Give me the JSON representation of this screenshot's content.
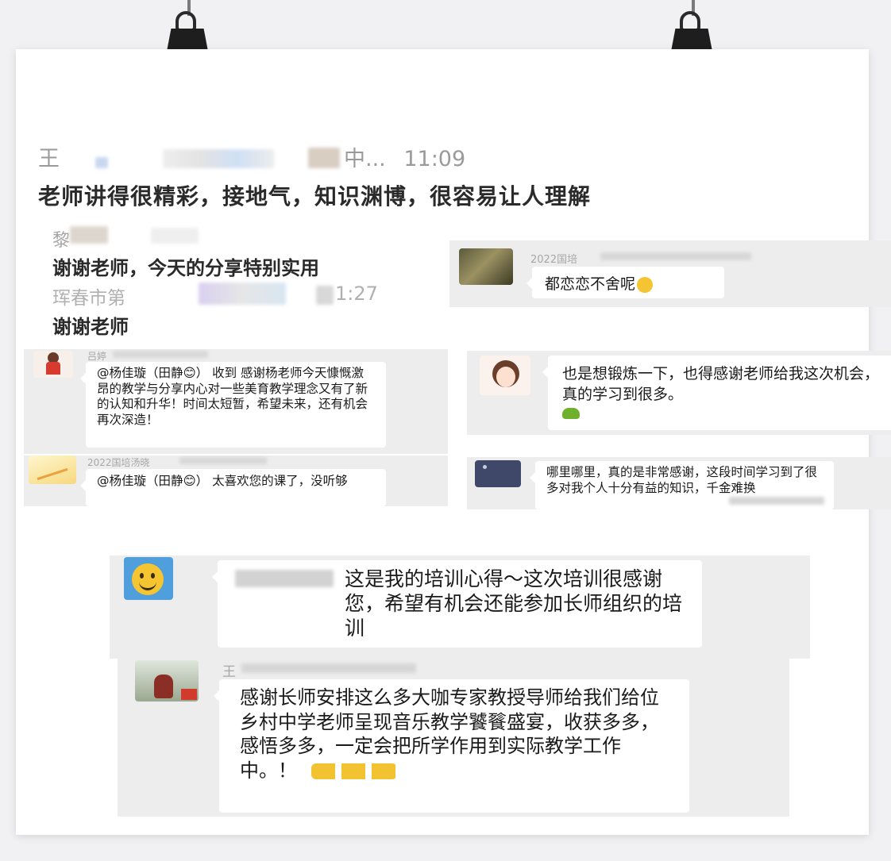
{
  "top": {
    "sender_name": "王",
    "sender_suffix": "中...",
    "time": "11:09",
    "message": "老师讲得很精彩，接地气，知识渊博，很容易让人理解"
  },
  "chat_2": {
    "sender": "黎",
    "message": "谢谢老师，今天的分享特别实用"
  },
  "chat_3": {
    "sender": "珲春市第",
    "time": "1:27",
    "message": "谢谢老师"
  },
  "card_a": {
    "group_name": "2022国培",
    "message": "都恋恋不舍呢"
  },
  "card_b": {
    "sender": "吕婷",
    "mention": "@杨佳璇（田静",
    "message": "@杨佳璇（田静😊） 收到 感谢杨老师今天慷慨激昂的教学与分享内心对一些美育教学理念又有了新的认知和升华！时间太短暂，希望未来，还有机会再次深造！"
  },
  "card_c": {
    "message": "也是想锻炼一下，也得感谢老师给我这次机会，真的学习到很多。"
  },
  "card_d": {
    "group_name": "2022国培汤晓",
    "message": "@杨佳璇（田静😊） 太喜欢您的课了，没听够"
  },
  "card_e": {
    "message": "哪里哪里，真的是非常感谢，这段时间学习到了很多对我个人十分有益的知识，千金难换"
  },
  "card_f": {
    "message": "这是我的培训心得～这次培训很感谢您，希望有机会还能参加长师组织的培训"
  },
  "card_g": {
    "sender": "王",
    "message": "感谢长师安排这么多大咖专家教授导师给我们给位乡村中学老师呈现音乐教学饕餮盛宴，收获多多，感悟多多，一定会把所学作用到实际教学工作中。！"
  },
  "icons": [
    "binder-clip-icon",
    "smiley-emoji-icon",
    "thumbs-up-emoji-icon"
  ],
  "colors": {
    "board": "#ffffff",
    "background": "#f1f1f3",
    "chat_grey": "#ededed",
    "meta_text": "#a7a7a7"
  }
}
